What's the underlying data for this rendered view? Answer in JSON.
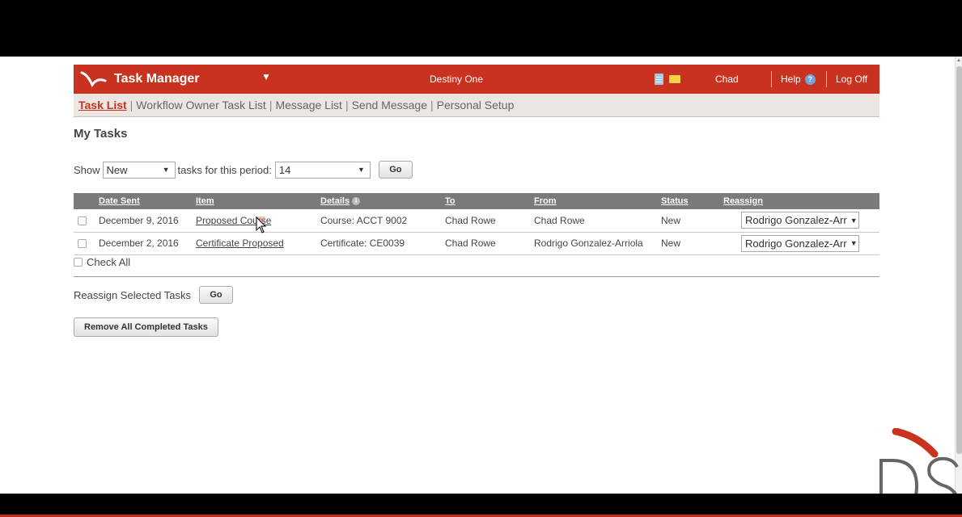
{
  "header": {
    "app_title": "Task Manager",
    "center_title": "Destiny One",
    "user": "Chad",
    "help": "Help",
    "logoff": "Log Off",
    "icons": [
      "document-icon",
      "mail-icon",
      "help-icon"
    ]
  },
  "subnav": {
    "items": [
      "Task List",
      "Workflow Owner Task List",
      "Message List",
      "Send Message",
      "Personal Setup"
    ],
    "active": "Task List"
  },
  "page_title": "My Tasks",
  "filter": {
    "show_label": "Show",
    "show_value": "New",
    "period_label": "tasks for this period:",
    "period_value": "14",
    "go_label": "Go"
  },
  "table": {
    "headers": [
      "Date Sent",
      "Item",
      "Details",
      "To",
      "From",
      "Status",
      "Reassign"
    ],
    "rows": [
      {
        "date": "December 9, 2016",
        "item": "Proposed Course",
        "details": "Course: ACCT 9002",
        "to": "Chad Rowe",
        "from": "Chad Rowe",
        "status": "New",
        "reassign": "Rodrigo Gonzalez-Arr"
      },
      {
        "date": "December 2, 2016",
        "item": "Certificate Proposed",
        "details": "Certificate: CE0039",
        "to": "Chad Rowe",
        "from": "Rodrigo Gonzalez-Arriola",
        "status": "New",
        "reassign": "Rodrigo Gonzalez-Arr"
      }
    ]
  },
  "check_all": "Check All",
  "reassign_selected": {
    "label": "Reassign Selected Tasks",
    "go_label": "Go"
  },
  "remove_completed": "Remove All Completed Tasks",
  "colors": {
    "brand": "#c8321f",
    "subnav_bg": "#ece6e2",
    "table_header": "#7a7a7a"
  }
}
